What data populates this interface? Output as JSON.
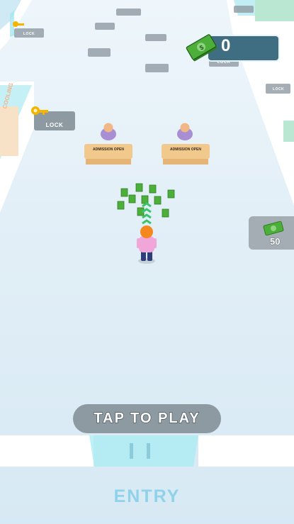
{
  "hud": {
    "money_value": "0",
    "money_icon": "cash-stack-icon"
  },
  "lock_labels": {
    "left_lock": "LOCK",
    "top_left_lock": "LOCK",
    "hud_lock": "LOCK",
    "right_lock": "LOCK"
  },
  "desks": [
    {
      "label": "ADMISSION OPEN"
    },
    {
      "label": "ADMISSION OPEN"
    }
  ],
  "side_wall_label": "COOLING",
  "unlock_price": "50",
  "play_button": {
    "label": "TAP TO PLAY"
  },
  "entry_label": "ENTRY",
  "colors": {
    "floor": "#e3eff7",
    "money_box": "#3f6e82",
    "cash_green": "#4caf3a",
    "desk": "#f2c98d",
    "player_hair": "#f5871f",
    "player_shirt": "#f0a6d8",
    "entry_text": "#8fd2ea",
    "play_button": "#8e9aa2"
  }
}
